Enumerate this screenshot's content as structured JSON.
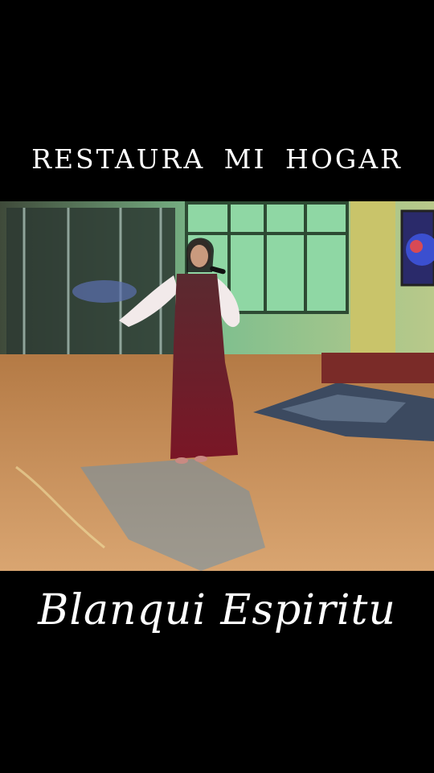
{
  "title": "RESTAURA MI HOGAR",
  "artist": "Blanqui Espiritu",
  "colors": {
    "background": "#000000",
    "text": "#ffffff",
    "dress": "#6e1a2b"
  }
}
